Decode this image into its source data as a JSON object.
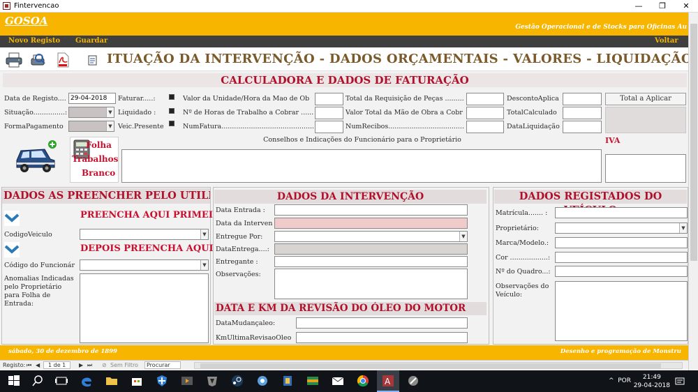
{
  "window": {
    "title": "Fintervencao",
    "minimize": "—",
    "restore": "❐",
    "close": "✕"
  },
  "header": {
    "logo": "GOSOA",
    "tagline": "Gestão Operacional e de Stocks para Oficinas Au"
  },
  "commands": {
    "new": "Novo Registo",
    "save": "Guardar",
    "back": "Voltar"
  },
  "page_title": "ITUAÇÃO DA INTERVENÇÃO - DADOS ORÇAMENTAIS - VALORES - LIQUIDAÇÃO",
  "calc": {
    "heading": "CALCULADORA E DADOS DE FATURAÇÃO",
    "data_registo_label": "Data de Registo....",
    "data_registo_value": "29-04-2018",
    "situacao_label": "Situação...............:",
    "forma_pagamento_label": "FormaPagamento",
    "faturar_label": "Faturar.....:",
    "liquidado_label": "Liquidado :",
    "veic_presente_label": "Veic.Presente",
    "valor_unidade_label": "Valor da Unidade/Hora da Mao de Ob",
    "horas_trabalho_label": "Nº de Horas de Trabalho a Cobrar ......",
    "num_fatura_label": "NumFatura.................................................:",
    "total_requisicao_label": "Total da Requisição de Peças ..........",
    "valor_total_mao_label": "Valor Total da Mão de Obra a Cobr",
    "num_recibos_label": "NumRecibos..........................................:",
    "desconto_label": "DescontoAplica",
    "total_calculado_label": "TotalCalculado",
    "data_liquidacao_label": "DataLiquidação",
    "total_aplicar_button": "Total a Aplicar",
    "conselhos_label": "Conselhos e Indicações do Funcionário para o Proprietário",
    "iva_label": "IVA",
    "folha_line1": "Folha",
    "folha_line2": "Trabalhos",
    "folha_line3": "Branco"
  },
  "user_panel": {
    "heading": "DADOS AS PREENCHER PELO UTILIZADOR",
    "fill_first": "PREENCHA AQUI PRIMEIRO",
    "codigo_veiculo_label": "CodigoVeiculo",
    "fill_after": "DEPOIS PREENCHA AQUI",
    "codigo_funcionario_label": "Código do Funcionár",
    "anomalias_label": "Anomalias Indicadas pelo Proprietário para Folha de Entrada:"
  },
  "intervention_panel": {
    "heading": "DADOS DA INTERVENÇÃO",
    "data_entrada_label": "Data  Entrada :",
    "data_intervencao_label": "Data da Interven",
    "entregue_por_label": "Entregue Por:",
    "data_entrega_label": "DataEntrega....:",
    "entregante_label": "Entregante :",
    "observacoes_label": "Observações:",
    "oil_heading": "DATA E KM DA REVISÃO DO ÓLEO DO MOTOR",
    "data_mudanca_label": "DataMudançaleo:",
    "km_ultima_label": "KmUltimaRevisaoOleo"
  },
  "vehicle_panel": {
    "heading": "DADOS REGISTADOS DO VEÍCULO",
    "matricula_label": "Matrícula....... :",
    "proprietario_label": "Proprietário:",
    "marca_label": "Marca/Modelo.:",
    "cor_label": "Cor ..................:",
    "quadro_label": "Nº do Quadro...:",
    "observacoes_label": "Observações do Veículo:"
  },
  "footer": {
    "date": "sábado, 30 de dezembro de 1899",
    "credit": "Desenho e programação de Monstru"
  },
  "navigation": {
    "registo_label": "Registo:",
    "record": "1 de 1",
    "filter": "Sem Filtro",
    "search": "Procurar"
  },
  "taskbar": {
    "language": "POR",
    "time": "21:49",
    "date": "29-04-2018"
  },
  "colors": {
    "gold": "#f7b500",
    "dark_bar": "#3f3f3f",
    "section_red": "#b0102a",
    "title_brown": "#7a5a2a"
  }
}
